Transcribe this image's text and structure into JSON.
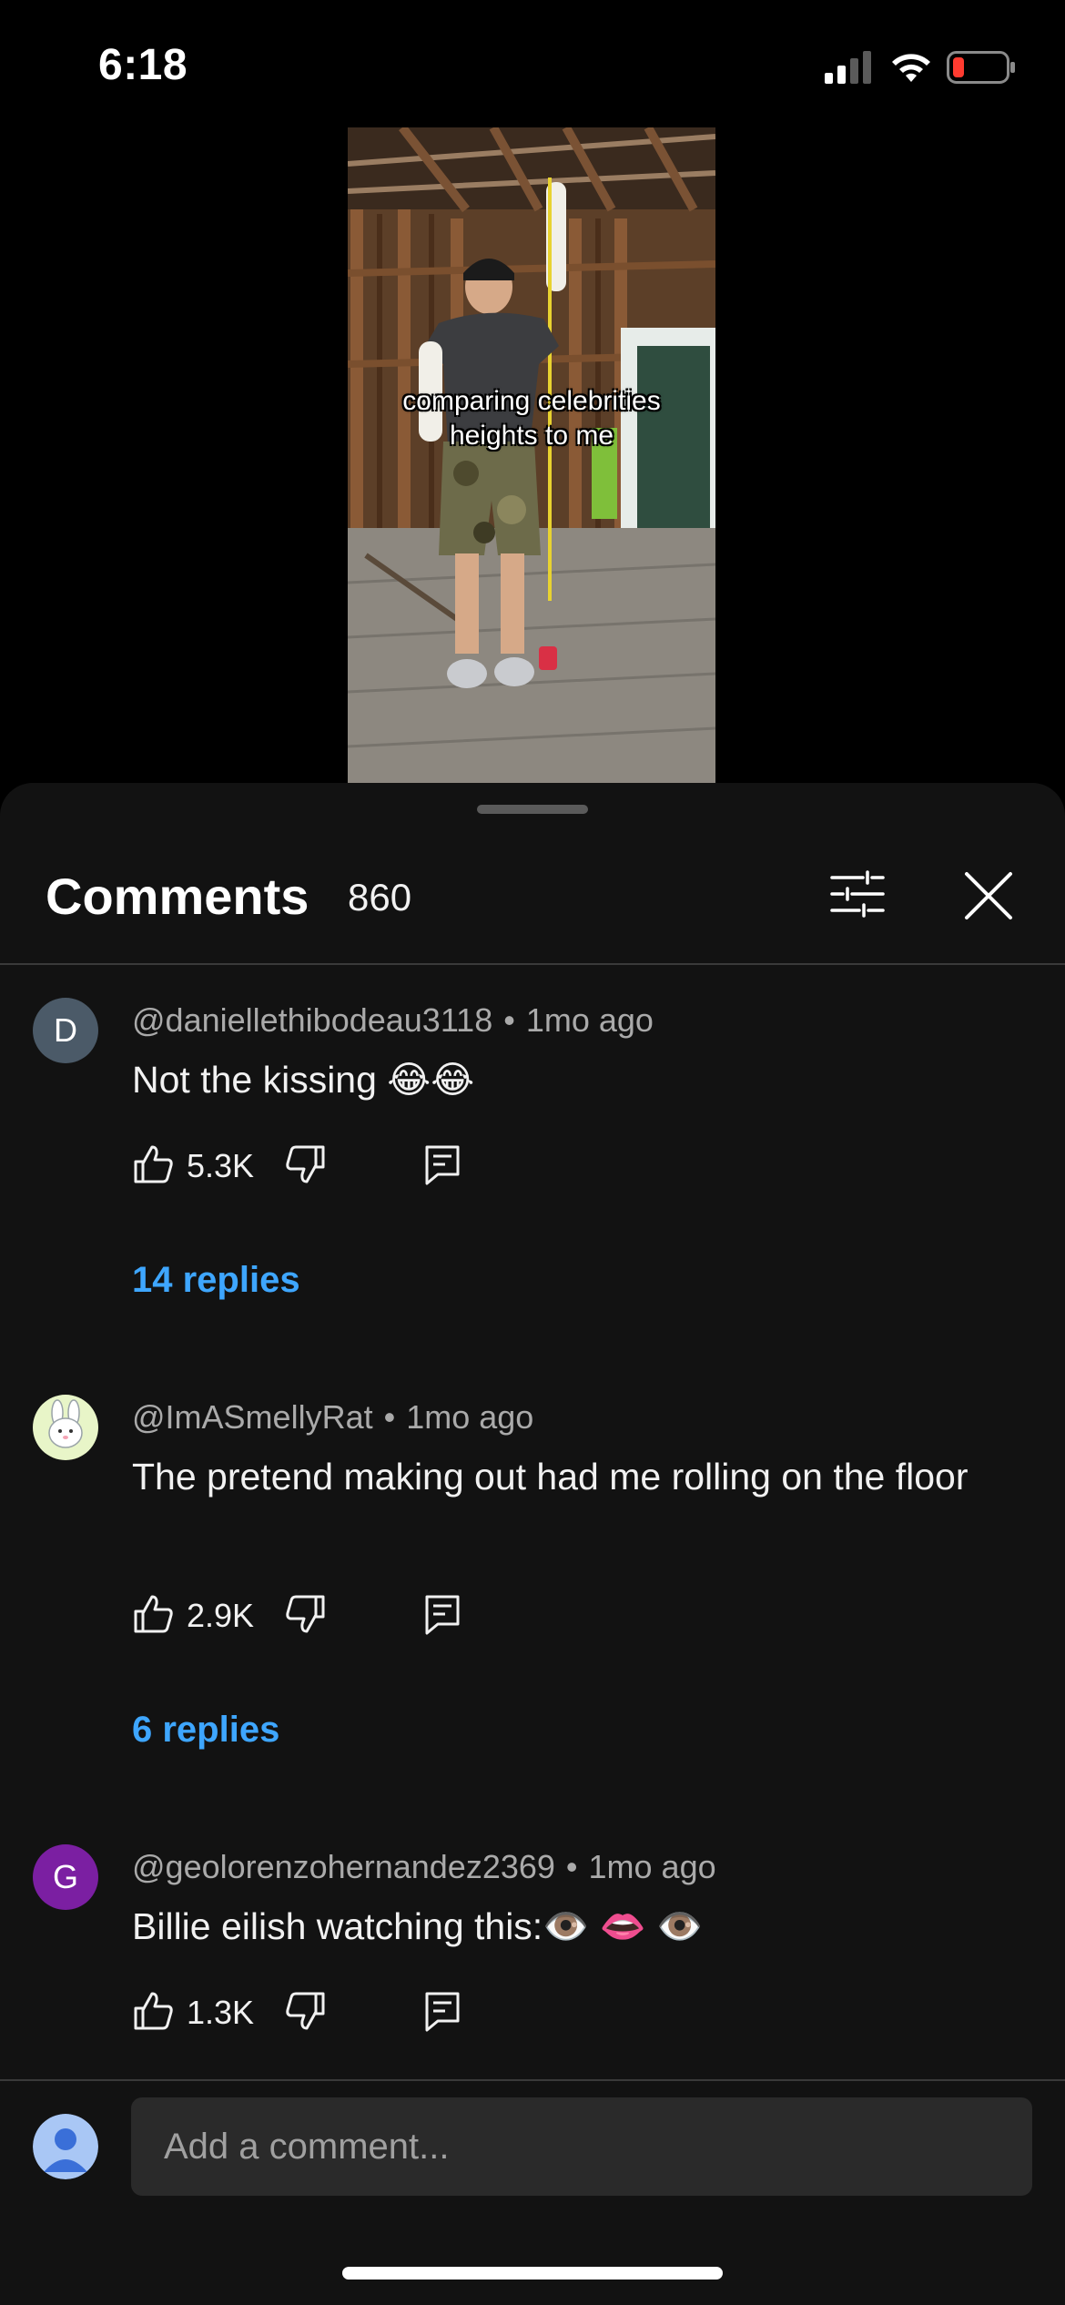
{
  "status_bar": {
    "time": "6:18"
  },
  "video": {
    "caption_line1": "comparing celebrities",
    "caption_line2": "heights to me"
  },
  "comments_panel": {
    "title": "Comments",
    "count": "860"
  },
  "comments": [
    {
      "author": "@daniellethibodeau3118",
      "separator": "•",
      "time": "1mo ago",
      "text": "Not the kissing 😂😂",
      "likes": "5.3K",
      "replies_label": "14 replies",
      "avatar_letter": "D",
      "avatar_color": "#4b5a68"
    },
    {
      "author": "@ImASmellyRat",
      "separator": "•",
      "time": "1mo ago",
      "text": "The pretend making out had me rolling on the floor",
      "likes": "2.9K",
      "replies_label": "6 replies",
      "avatar_color": "#e8f5c8"
    },
    {
      "author": "@geolorenzohernandez2369",
      "separator": "•",
      "time": "1mo ago",
      "text": "Billie eilish watching this:👁️ 👄 👁️",
      "likes": "1.3K",
      "avatar_letter": "G",
      "avatar_color": "#7b1fa2"
    }
  ],
  "comment_input": {
    "placeholder": "Add a comment..."
  },
  "colors": {
    "background": "#000000",
    "sheet": "#121212",
    "link_blue": "#3ea6ff",
    "meta_gray": "#aaaaaa"
  }
}
